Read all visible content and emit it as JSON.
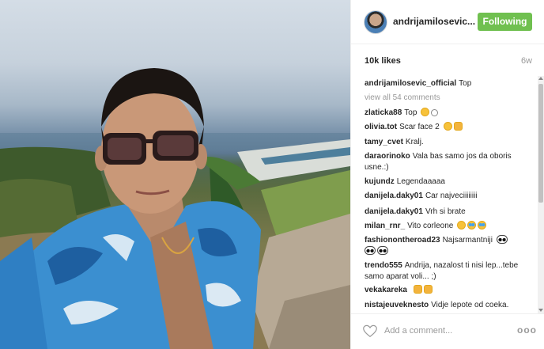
{
  "header": {
    "username": "andrijamilosevic...",
    "follow_label": "Following"
  },
  "meta": {
    "likes": "10k likes",
    "time": "6w"
  },
  "caption": {
    "user": "andrijamilosevic_official",
    "text": "Top"
  },
  "view_all_label": "view all 54 comments",
  "comments": [
    {
      "user": "zlaticka88",
      "text": "Top"
    },
    {
      "user": "olivia.tot",
      "text": "Scar face 2"
    },
    {
      "user": "tamy_cvet",
      "text": "Kralj."
    },
    {
      "user": "daraorinoko",
      "text": "Vala bas samo jos da oboris usne.:)"
    },
    {
      "user": "kujundz",
      "text": "Legendaaaaa"
    },
    {
      "user": "danijela.daky01",
      "text": "Car najveciiiiiiii"
    },
    {
      "user": "danijela.daky01",
      "text": "Vrh si brate"
    },
    {
      "user": "milan_rnr_",
      "text": "Vito corleone"
    },
    {
      "user": "fashionontheroad23",
      "text": "Najsarmantniji"
    },
    {
      "user": "trendo555",
      "text": "Andrija, nazalost ti nisi lep...tebe samo aparat voli... ;)"
    },
    {
      "user": "vekakareka",
      "text": ""
    },
    {
      "user": "nistajeuveknesto",
      "text": "Vidje lepote od coeka."
    }
  ],
  "add_comment": {
    "placeholder": "Add a comment...",
    "more_label": "ooo"
  },
  "icons": {
    "avatar": "profile-avatar",
    "like": "heart-outline-icon",
    "more": "more-options-icon"
  },
  "colors": {
    "follow_button": "#70c050",
    "muted_text": "#999999"
  }
}
